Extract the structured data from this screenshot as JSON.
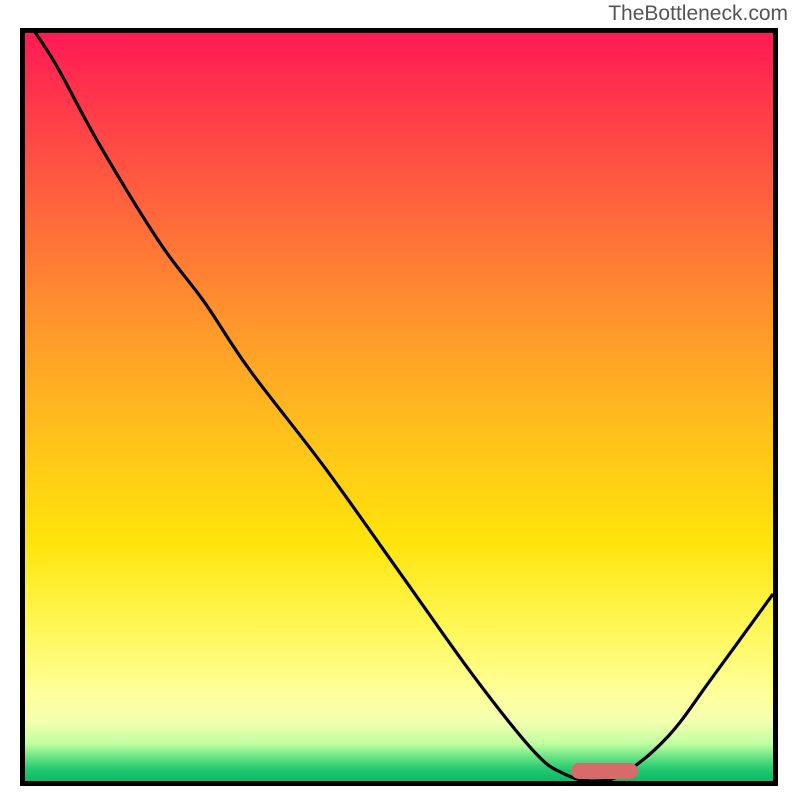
{
  "watermark": "TheBottleneck.com",
  "chart_data": {
    "type": "line",
    "title": "",
    "xlabel": "",
    "ylabel": "",
    "x": [
      0.0,
      0.04,
      0.1,
      0.18,
      0.24,
      0.3,
      0.4,
      0.5,
      0.6,
      0.68,
      0.72,
      0.76,
      0.8,
      0.86,
      0.92,
      1.0
    ],
    "y": [
      1.02,
      0.96,
      0.85,
      0.72,
      0.64,
      0.55,
      0.42,
      0.28,
      0.14,
      0.04,
      0.01,
      0.0,
      0.01,
      0.06,
      0.14,
      0.25
    ],
    "xlim": [
      0,
      1
    ],
    "ylim": [
      0,
      1
    ],
    "marker": {
      "x_start": 0.73,
      "x_end": 0.82,
      "y": 0.005
    },
    "gradient_stops": [
      {
        "pos": 0.0,
        "color": "#ff1a55"
      },
      {
        "pos": 0.5,
        "color": "#ffc41a"
      },
      {
        "pos": 0.9,
        "color": "#ffff9a"
      },
      {
        "pos": 1.0,
        "color": "#10b868"
      }
    ]
  }
}
